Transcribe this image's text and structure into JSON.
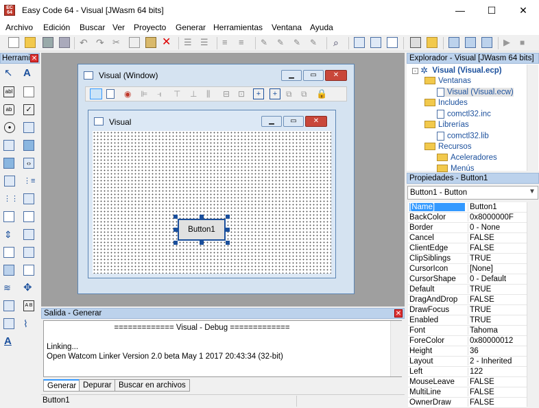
{
  "window": {
    "title": "Easy Code 64 - Visual [JWasm 64 bits]",
    "minimize": "—",
    "maximize": "☐",
    "close": "✕"
  },
  "menu": [
    "Archivo",
    "Edición",
    "Buscar",
    "Ver",
    "Proyecto",
    "Generar",
    "Herramientas",
    "Ventana",
    "Ayuda"
  ],
  "toolbox": {
    "title": "Herramientas"
  },
  "designer": {
    "outer_title": "Visual (Window)",
    "inner_title": "Visual",
    "button_label": "Button1"
  },
  "output": {
    "title": "Salida - Generar",
    "lines": [
      "============= Visual - Debug =============",
      "",
      "Linking...",
      "Open Watcom Linker Version 2.0 beta May  1 2017 20:43:34 (32-bit)"
    ],
    "tabs": [
      "Generar",
      "Depurar",
      "Buscar en archivos"
    ]
  },
  "status": {
    "text": "Button1"
  },
  "explorer": {
    "title": "Explorador - Visual [JWasm 64 bits]",
    "root": "Visual (Visual.ecp)",
    "items": [
      {
        "label": "Ventanas",
        "kind": "folder",
        "indent": 1
      },
      {
        "label": "Visual (Visual.ecw)",
        "kind": "file",
        "indent": 2
      },
      {
        "label": "Includes",
        "kind": "folder",
        "indent": 1
      },
      {
        "label": "comctl32.inc",
        "kind": "file",
        "indent": 2
      },
      {
        "label": "Librerías",
        "kind": "folder",
        "indent": 1
      },
      {
        "label": "comctl32.lib",
        "kind": "file",
        "indent": 2
      },
      {
        "label": "Recursos",
        "kind": "folder",
        "indent": 1
      },
      {
        "label": "Aceleradores",
        "kind": "folder",
        "indent": 2
      },
      {
        "label": "Menús",
        "kind": "folder",
        "indent": 2
      }
    ]
  },
  "properties": {
    "title": "Propiedades - Button1",
    "selector": "Button1 - Button",
    "rows": [
      [
        "[Name]",
        "Button1"
      ],
      [
        "BackColor",
        "0x8000000F"
      ],
      [
        "Border",
        "0 - None"
      ],
      [
        "Cancel",
        "FALSE"
      ],
      [
        "ClientEdge",
        "FALSE"
      ],
      [
        "ClipSiblings",
        "TRUE"
      ],
      [
        "CursorIcon",
        "[None]"
      ],
      [
        "CursorShape",
        "0 - Default"
      ],
      [
        "Default",
        "TRUE"
      ],
      [
        "DragAndDrop",
        "FALSE"
      ],
      [
        "DrawFocus",
        "TRUE"
      ],
      [
        "Enabled",
        "TRUE"
      ],
      [
        "Font",
        "Tahoma"
      ],
      [
        "ForeColor",
        "0x80000012"
      ],
      [
        "Height",
        "36"
      ],
      [
        "Layout",
        "2 - Inherited"
      ],
      [
        "Left",
        "122"
      ],
      [
        "MouseLeave",
        "FALSE"
      ],
      [
        "MultiLine",
        "FALSE"
      ],
      [
        "OwnerDraw",
        "FALSE"
      ]
    ]
  },
  "colors": {
    "panel_header": "#bcd2ec",
    "selection": "#3399ff",
    "accent": "#1a4f9c"
  }
}
